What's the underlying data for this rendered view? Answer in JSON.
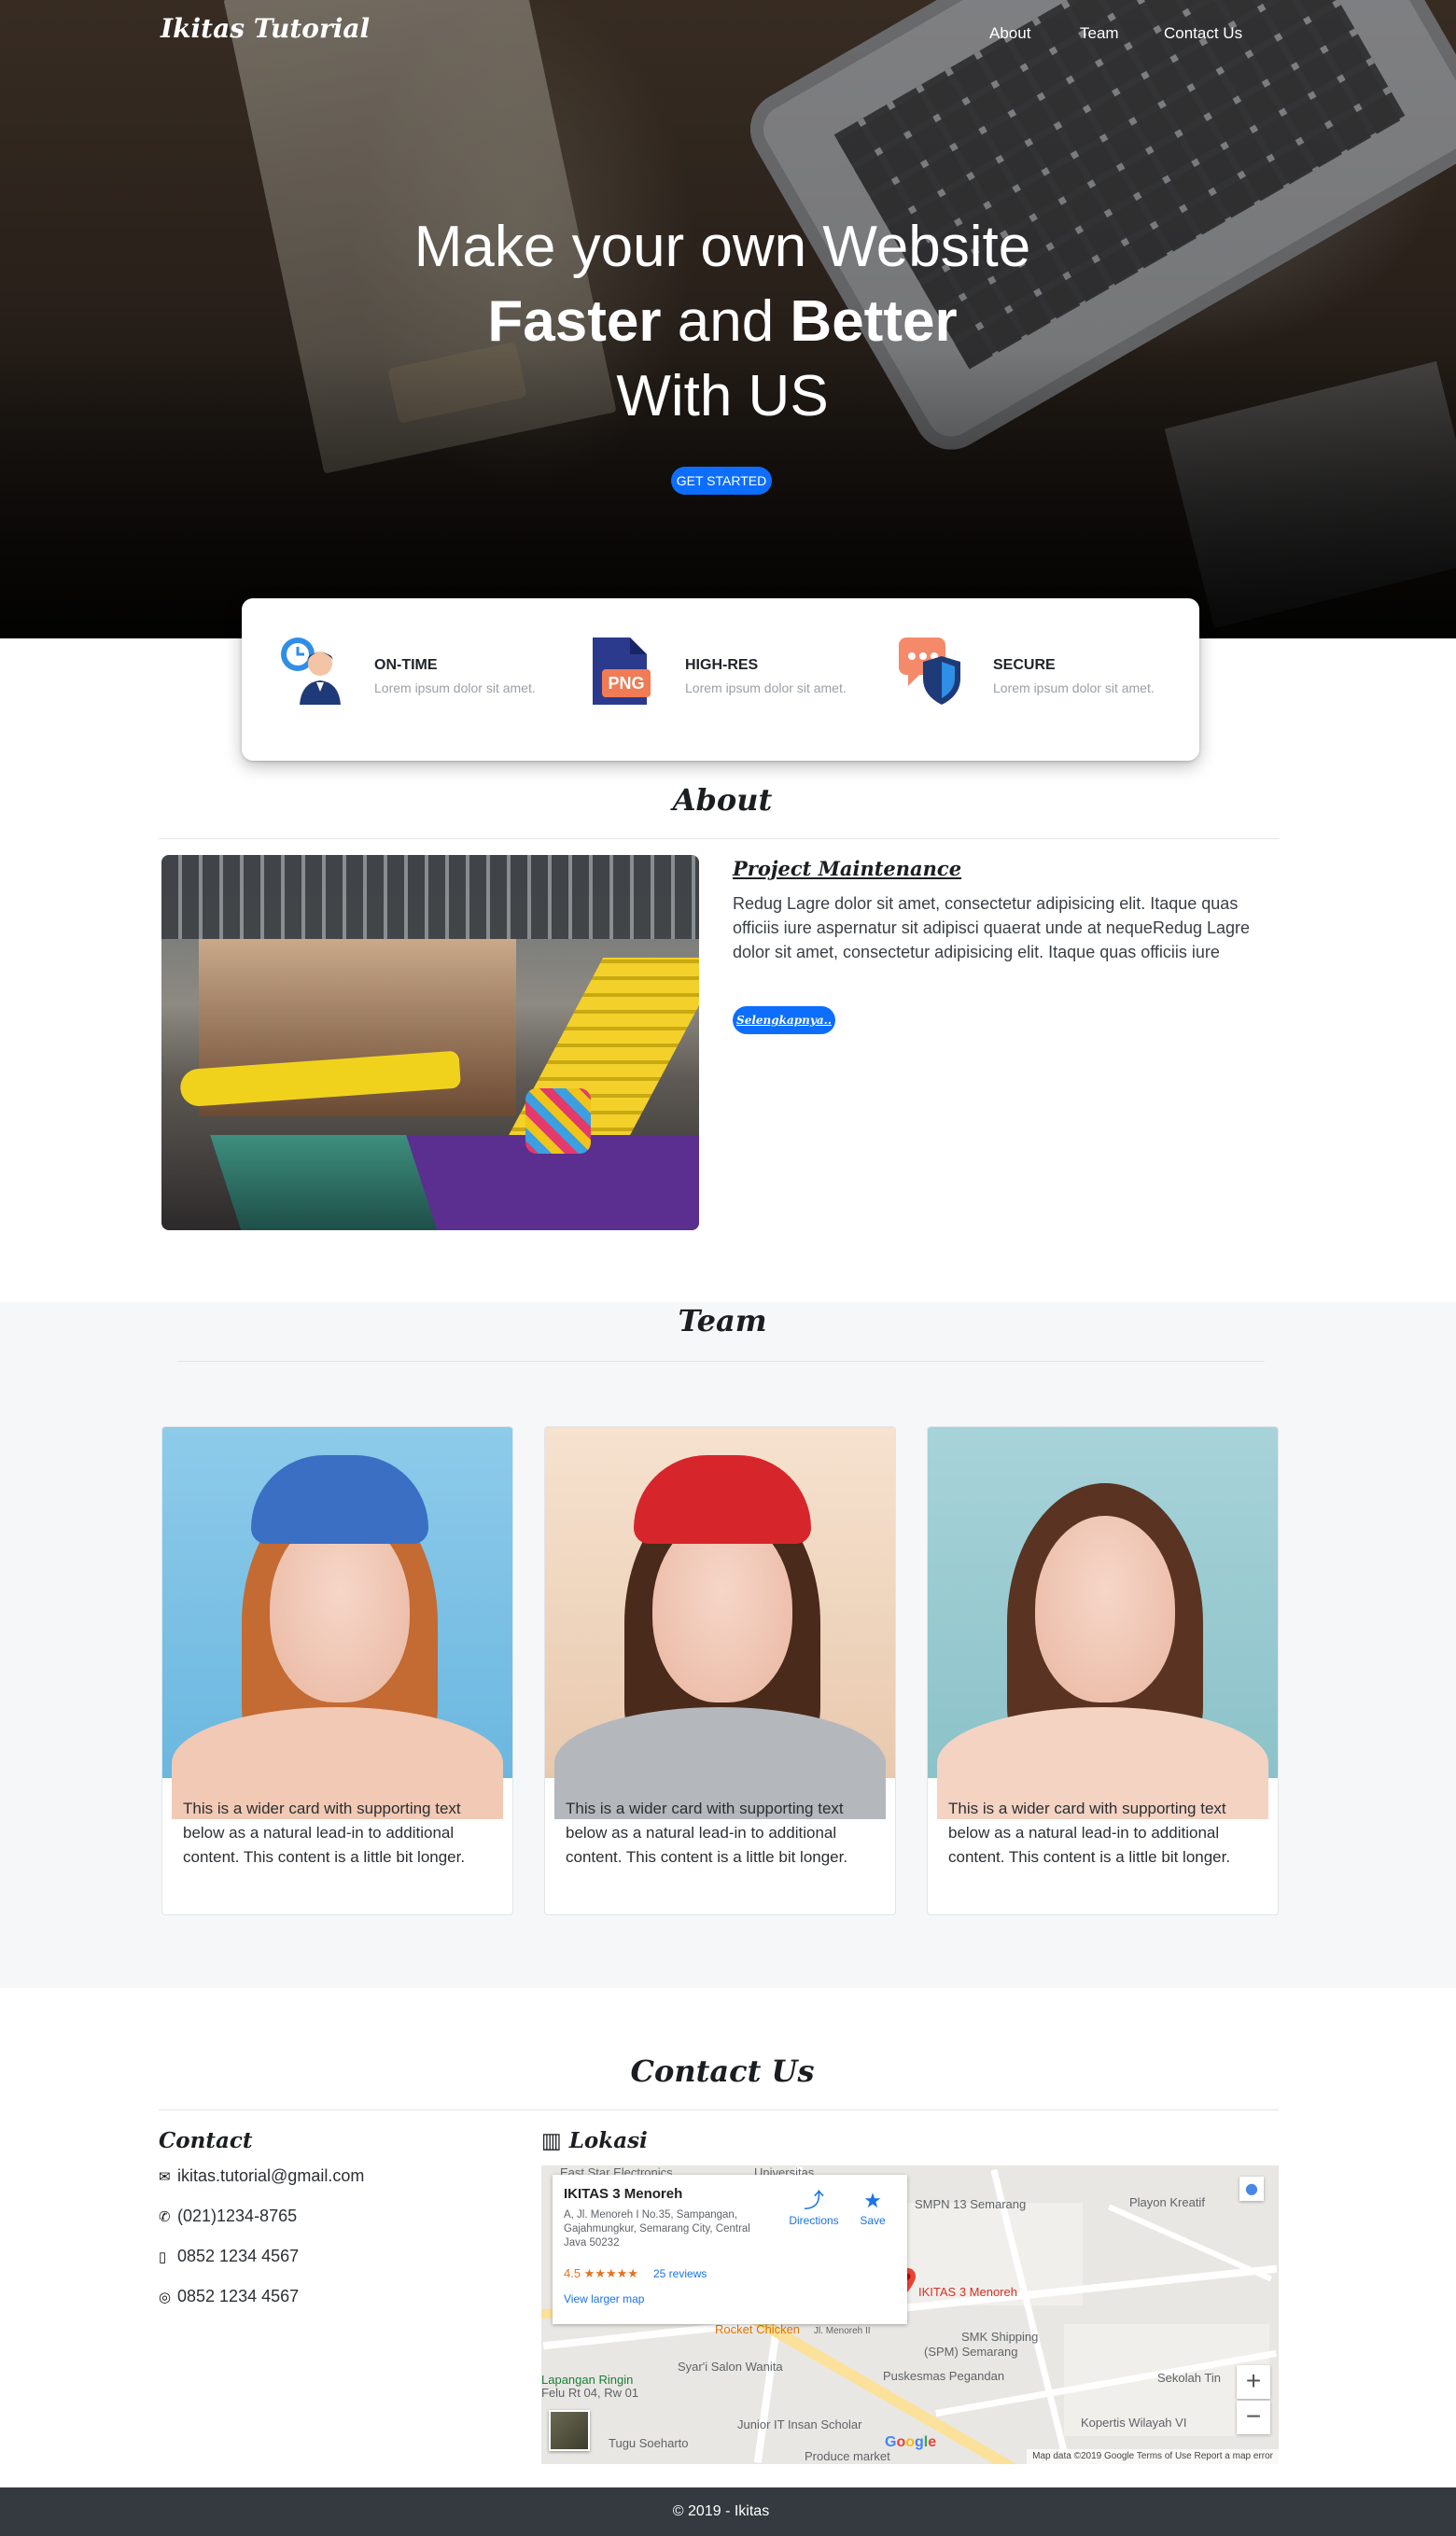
{
  "navbar": {
    "brand": "Ikitas Tutorial",
    "links": [
      "About",
      "Team",
      "Contact Us"
    ]
  },
  "hero": {
    "line1": "Make your own Website",
    "line2_bold1": "Faster",
    "line2_mid": "and",
    "line2_bold2": "Better",
    "line3": "With US",
    "button": "GET STARTED"
  },
  "features": [
    {
      "icon": "on-time-icon",
      "title": "ON-TIME",
      "text": "Lorem ipsum dolor sit amet."
    },
    {
      "icon": "png-file-icon",
      "title": "HIGH-RES",
      "text": "Lorem ipsum dolor sit amet."
    },
    {
      "icon": "secure-shield-icon",
      "title": "SECURE",
      "text": "Lorem ipsum dolor sit amet."
    }
  ],
  "about": {
    "title": "About",
    "heading": "Project Maintenance",
    "text": "Redug Lagre dolor sit amet, consectetur adipisicing elit. Itaque quas officiis iure aspernatur sit adipisci quaerat unde at nequeRedug Lagre dolor sit amet, consectetur adipisicing elit. Itaque quas officiis iure",
    "button": "Selengkapnya.."
  },
  "team": {
    "title": "Team",
    "cards": [
      {
        "text": "This is a wider card with supporting text below as a natural lead-in to additional content. This content is a little bit longer."
      },
      {
        "text": "This is a wider card with supporting text below as a natural lead-in to additional content. This content is a little bit longer."
      },
      {
        "text": "This is a wider card with supporting text below as a natural lead-in to additional content. This content is a little bit longer."
      }
    ]
  },
  "contact": {
    "title": "Contact Us",
    "heading": "Contact",
    "email": "ikitas.tutorial@gmail.com",
    "phone": "(021)1234-8765",
    "mobile": "0852 1234 4567",
    "whatsapp": "0852 1234 4567"
  },
  "location": {
    "heading": "Lokasi",
    "place_name": "IKITAS 3 Menoreh",
    "address": "A, Jl. Menoreh I No.35, Sampangan, Gajahmungkur, Semarang City, Central Java 50232",
    "rating": "4.5 ★★★★★",
    "reviews": "25 reviews",
    "larger_map": "View larger map",
    "directions": "Directions",
    "save": "Save",
    "marker_label": "IKITAS 3 Menoreh",
    "labels": {
      "east_star": "East Star Electronics",
      "universitas": "Universitas",
      "smpn": "SMPN 13 Semarang",
      "playon": "Playon Kreatif",
      "rocket": "Rocket Chicken",
      "jl_menoreh": "Jl. Menoreh II",
      "smk": "SMK Shipping",
      "spm": "(SPM) Semarang",
      "lapangan": "Lapangan Ringin",
      "felu": "Felu Rt 04, Rw 01",
      "syari": "Syar'i Salon Wanita",
      "puskesmas": "Puskesmas Pegandan",
      "sekolah": "Sekolah Tin",
      "junior": "Junior IT Insan Scholar",
      "tugu": "Tugu Soeharto",
      "kopertis": "Kopertis Wilayah VI",
      "produce": "Produce market"
    },
    "google": "Google",
    "footer": "Map data ©2019 Google    Terms of Use    Report a map error",
    "zoom_in": "+",
    "zoom_out": "−"
  },
  "footer": {
    "text": "© 2019 - Ikitas"
  },
  "colors": {
    "primary": "#0d6efd",
    "footer_bg": "#343a40",
    "team_bg": "#f6f7f9"
  }
}
